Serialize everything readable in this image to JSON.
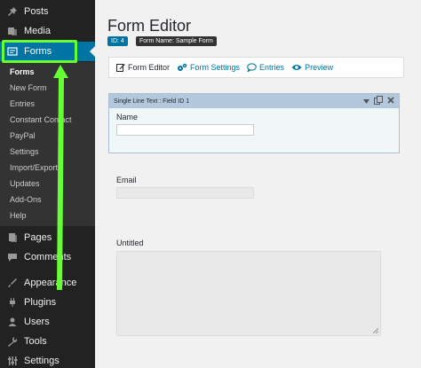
{
  "sidebar": {
    "menu": [
      {
        "label": "Posts",
        "icon": "pushpin-icon"
      },
      {
        "label": "Media",
        "icon": "media-icon"
      },
      {
        "label": "Forms",
        "icon": "forms-icon",
        "active": true
      },
      {
        "label": "Pages",
        "icon": "pages-icon"
      },
      {
        "label": "Comments",
        "icon": "comments-icon"
      },
      {
        "label": "Appearance",
        "icon": "appearance-icon"
      },
      {
        "label": "Plugins",
        "icon": "plugins-icon"
      },
      {
        "label": "Users",
        "icon": "users-icon"
      },
      {
        "label": "Tools",
        "icon": "tools-icon"
      },
      {
        "label": "Settings",
        "icon": "settings-icon"
      }
    ],
    "submenu": [
      {
        "label": "Forms",
        "current": true
      },
      {
        "label": "New Form"
      },
      {
        "label": "Entries"
      },
      {
        "label": "Constant Contact"
      },
      {
        "label": "PayPal"
      },
      {
        "label": "Settings"
      },
      {
        "label": "Import/Export"
      },
      {
        "label": "Updates"
      },
      {
        "label": "Add-Ons"
      },
      {
        "label": "Help"
      }
    ]
  },
  "main": {
    "title": "Form Editor",
    "badges": {
      "id": "ID: 4",
      "name": "Form Name: Sample Form"
    },
    "toolbar": {
      "form_editor": "Form Editor",
      "form_settings": "Form Settings",
      "entries": "Entries",
      "preview": "Preview"
    },
    "fields": {
      "selected_header": "Single Line Text : Field ID 1",
      "name_label": "Name",
      "email_label": "Email",
      "untitled_label": "Untitled"
    }
  },
  "colors": {
    "sidebar_bg": "#222222",
    "active_blue": "#0074a2",
    "highlight_green": "#66ff33",
    "field_header": "#b3c8dc"
  }
}
